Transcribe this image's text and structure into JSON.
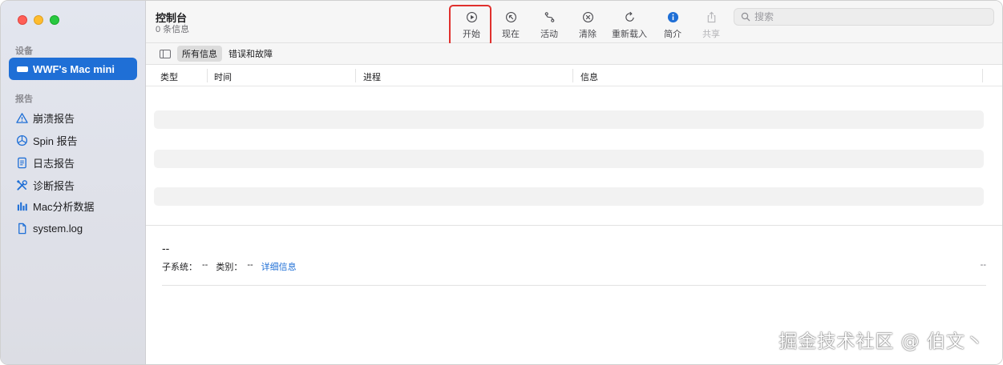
{
  "window": {
    "title": "控制台",
    "subtitle": "0 条信息"
  },
  "sidebar": {
    "devices_label": "设备",
    "device": "WWF's Mac mini",
    "reports_label": "报告",
    "items": [
      {
        "label": "崩溃报告",
        "icon": "warning-triangle-icon"
      },
      {
        "label": "Spin 报告",
        "icon": "spin-icon"
      },
      {
        "label": "日志报告",
        "icon": "document-icon"
      },
      {
        "label": "诊断报告",
        "icon": "tools-icon"
      },
      {
        "label": "Mac分析数据",
        "icon": "bar-chart-icon"
      },
      {
        "label": "system.log",
        "icon": "file-icon"
      }
    ]
  },
  "toolbar": {
    "start": "开始",
    "now": "现在",
    "activity": "活动",
    "clear": "清除",
    "reload": "重新载入",
    "info": "简介",
    "share": "共享",
    "search_placeholder": "搜索"
  },
  "filters": {
    "all": "所有信息",
    "errors": "错误和故障"
  },
  "table": {
    "columns": [
      "类型",
      "时间",
      "进程",
      "信息"
    ]
  },
  "detail": {
    "dash": "--",
    "subsystem_label": "子系统：",
    "subsystem_value": "--",
    "category_label": "类别：",
    "category_value": "--",
    "details_link": "详细信息",
    "right_value": "--"
  },
  "watermark": "掘金技术社区 @ 伯文丶",
  "colors": {
    "accent": "#1f6fd6",
    "highlight": "#e0302d"
  }
}
